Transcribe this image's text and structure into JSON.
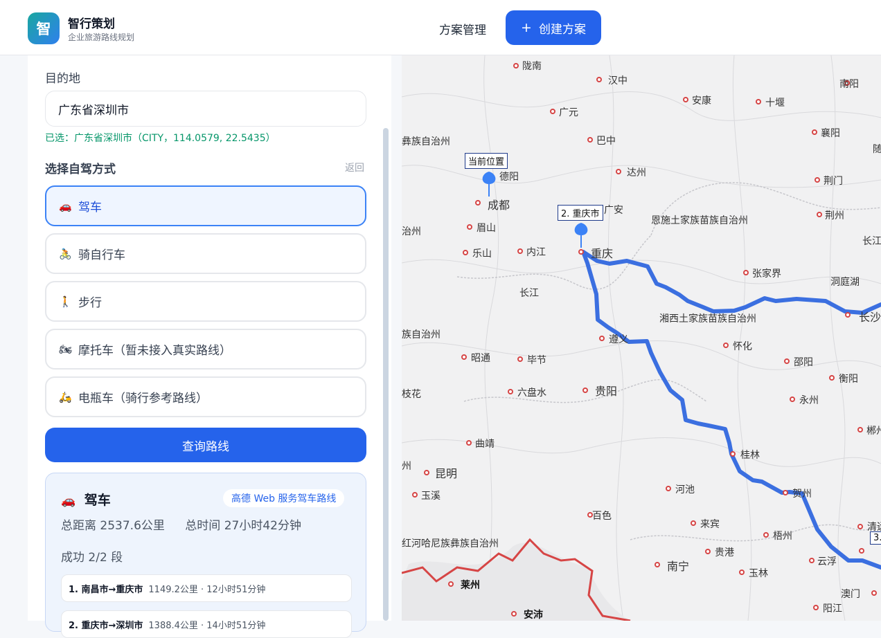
{
  "header": {
    "logo_char": "智",
    "brand_name": "智行策划",
    "brand_sub": "企业旅游路线规划",
    "nav_manage": "方案管理",
    "create_plus": "+",
    "create_label": "创建方案"
  },
  "form": {
    "dest_label": "目的地",
    "dest_value": "广东省深圳市",
    "dest_selected": "已选：广东省深圳市（CITY，114.0579, 22.5435）",
    "mode_title": "选择自驾方式",
    "back": "返回",
    "modes": [
      {
        "emoji": "🚗",
        "label": "驾车"
      },
      {
        "emoji": "🚴",
        "label": "骑自行车"
      },
      {
        "emoji": "🚶",
        "label": "步行"
      },
      {
        "emoji": "🏍",
        "label": "摩托车（暂未接入真实路线）"
      },
      {
        "emoji": "🛵",
        "label": "电瓶车（骑行参考路线）"
      }
    ],
    "query_button": "查询路线"
  },
  "result": {
    "emoji": "🚗",
    "title": "驾车",
    "badge": "高德 Web 服务驾车路线",
    "distance": "总距离 2537.6公里",
    "time": "总时间 27小时42分钟",
    "success": "成功 2/2 段",
    "segments": [
      {
        "name": "1. 南昌市→重庆市",
        "detail": "1149.2公里 · 12小时51分钟"
      },
      {
        "name": "2. 重庆市→深圳市",
        "detail": "1388.4公里 · 14小时51分钟"
      }
    ]
  },
  "map": {
    "route_color": "#3b6fe0",
    "border_color": "#d64545",
    "markers": [
      {
        "label": "当前位置"
      },
      {
        "label": "2. 重庆市"
      },
      {
        "label": "3."
      }
    ],
    "cities": [
      "陇南",
      "汉中",
      "南阳",
      "安康",
      "十堰",
      "广元",
      "巴中",
      "襄阳",
      "随",
      "德阳",
      "达州",
      "荆门",
      "成都",
      "广安",
      "荆州",
      "眉山",
      "恩施土家族苗族自治州",
      "长江",
      "乐山",
      "内江",
      "重庆",
      "张家界",
      "洞庭湖",
      "长江",
      "湘西土家族苗族自治州",
      "长沙",
      "遵义",
      "怀化",
      "昭通",
      "毕节",
      "邵阳",
      "六盘水",
      "贵阳",
      "衡阳",
      "永州",
      "曲靖",
      "桂林",
      "郴州",
      "昆明",
      "河池",
      "贺州",
      "玉溪",
      "百色",
      "来宾",
      "清远",
      "梧州",
      "贵港",
      "云浮",
      "南宁",
      "玉林",
      "澳门",
      "阳江",
      "莱州",
      "安沛",
      "彝族自治州",
      "治州",
      "族自治州",
      "枝花",
      "州",
      "红河哈尼族彝族自治州"
    ]
  }
}
